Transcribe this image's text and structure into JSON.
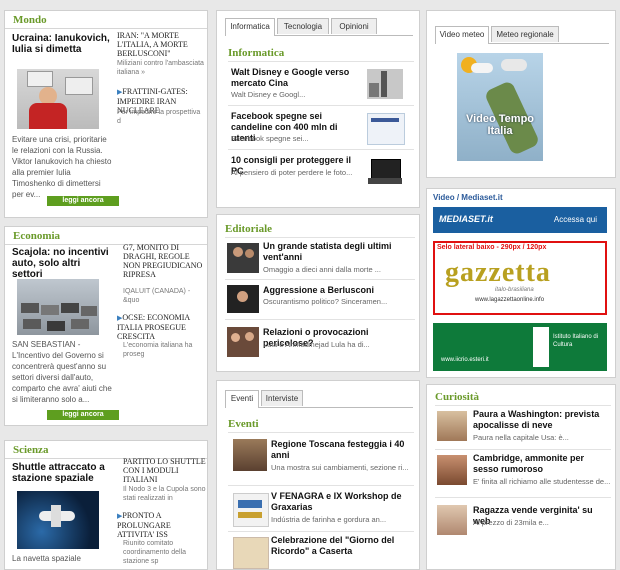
{
  "left": {
    "mondo": {
      "title": "Mondo",
      "lead_title": "Ucraina: Ianukovich, Iulia si dimetta",
      "lead_body": "Evitare una crisi, prioritarie le relazioni con la Russia. Viktor Ianukovich ha chiesto alla premier Iulia Timoshenko di dimettersi per ev...",
      "more": "leggi ancora",
      "subs": [
        {
          "title": "IRAN: \"A MORTE L'ITALIA, A MORTE BERLUSCONI\"",
          "body": "Miliziani contro l'ambasciata italiana »"
        },
        {
          "title": "FRATTINI-GATES: IMPEDIRE IRAN NUCLEARE",
          "body": "Per impedire la prospettiva d"
        }
      ]
    },
    "economia": {
      "title": "Economia",
      "lead_title": "Scajola: no incentivi auto, solo altri settori",
      "lead_body": "SAN SEBASTIAN - L'Incentivo del Governo si concentrerà quest'anno su settori diversi dall'auto, comparto che avra' aiuti che si limiteranno solo a...",
      "more": "leggi ancora",
      "subs": [
        {
          "title": "G7, MONITO DI DRAGHI, REGOLE NON PREGIUDICANO RIPRESA",
          "body": "IQALUIT (CANADA) - &quo"
        },
        {
          "title": "OCSE: ECONOMIA ITALIA PROSEGUE CRESCITA",
          "body": "L'economia italiana ha proseg"
        }
      ]
    },
    "scienza": {
      "title": "Scienza",
      "lead_title": "Shuttle attraccato a stazione spaziale",
      "lead_body": "La navetta spaziale",
      "subs": [
        {
          "title": "PARTITO LO SHUTTLE CON I MODULI ITALIANI",
          "body": "Il Nodo 3 e la Cupola sono stati realizzati in"
        },
        {
          "title": "PRONTO A PROLUNGARE ATTIVITA' ISS",
          "body": "Riunito comitato coordinamento della stazione sp"
        }
      ]
    }
  },
  "middle": {
    "tabs1": [
      "Informatica",
      "Tecnologia",
      "Opinioni"
    ],
    "informatica": {
      "title": "Informatica",
      "items": [
        {
          "title": "Walt Disney e Google verso mercato Cina",
          "body": "Walt Disney e Googl..."
        },
        {
          "title": "Facebook spegne sei candeline con 400 mln di utenti",
          "body": "Facebook spegne sei..."
        },
        {
          "title": "10 consigli per proteggere il PC",
          "body": "Al pensiero di poter perdere le foto..."
        }
      ]
    },
    "editoriale": {
      "title": "Editoriale",
      "items": [
        {
          "title": "Un grande statista degli ultimi vent'anni",
          "body": "Omaggio a dieci anni dalla morte ..."
        },
        {
          "title": "Aggressione a Berlusconi",
          "body": "Oscurantismo politico? Sinceramen..."
        },
        {
          "title": "Relazioni o provocazioni pericolose?",
          "body": "Lula e Ahmadinejad   Lula ha di..."
        }
      ]
    },
    "tabs2": [
      "Eventi",
      "Interviste"
    ],
    "eventi": {
      "title": "Eventi",
      "items": [
        {
          "title": "Regione Toscana festeggia i 40 anni",
          "body": "Una mostra sui cambiamenti, sezione ri..."
        },
        {
          "title": "V FENAGRA e IX Workshop de Graxarias",
          "body": "Indústria de farinha e gordura an..."
        },
        {
          "title": "Celebrazione del \"Giorno del Ricordo\" a Caserta",
          "body": ""
        }
      ]
    }
  },
  "right": {
    "video_tabs": [
      "Video meteo",
      "Meteo regionale"
    ],
    "video_text": "Video Tempo Italia",
    "mediaset_label": "Video / Mediaset.it",
    "mediaset_logo": "MEDIASET.it",
    "mediaset_link": "Accessa qui",
    "ad_label": "Selo lateral baixo - 290px / 120px",
    "ad_logo": "gazzetta",
    "ad_subtitle": "italo-brasiliana",
    "ad_url": "www.lagazzettaonline.info",
    "esteri_url": "www.iicrio.esteri.it",
    "esteri_text": "Istituto Italiano di Cultura",
    "curiosita": {
      "title": "Curiosità",
      "items": [
        {
          "title": "Paura a Washington: prevista apocalisse di neve",
          "body": "Paura nella capitale Usa: è..."
        },
        {
          "title": "Cambridge, ammonite per sesso rumoroso",
          "body": "E' finita all richiamo alle studentesse de..."
        },
        {
          "title": "Ragazza vende verginita' su web",
          "body": "Al prezzo di 23mila e..."
        }
      ]
    }
  },
  "colors": {
    "section": "#6a9a2a",
    "button": "#5e9e1f",
    "mediaset": "#1a5fa0",
    "ad_border": "#e01010",
    "esteri": "#0e7a3a"
  }
}
